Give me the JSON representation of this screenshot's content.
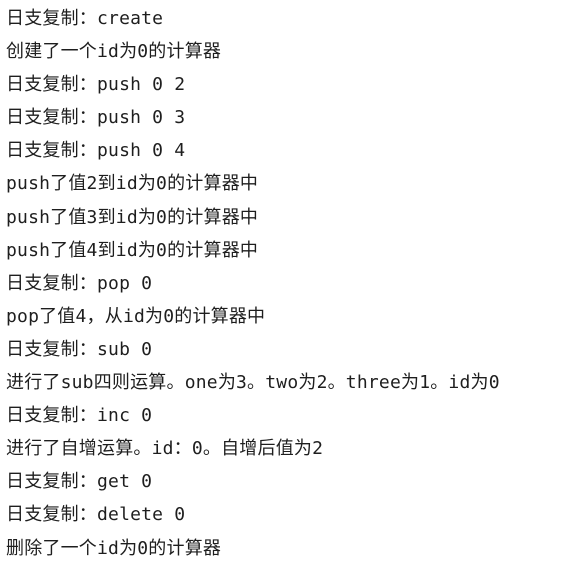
{
  "console": {
    "lines": [
      "日支复制：create",
      "创建了一个id为0的计算器",
      "日支复制：push 0 2",
      "日支复制：push 0 3",
      "日支复制：push 0 4",
      "push了值2到id为0的计算器中",
      "push了值3到id为0的计算器中",
      "push了值4到id为0的计算器中",
      "日支复制：pop 0",
      "pop了值4，从id为0的计算器中",
      "日支复制：sub 0",
      "进行了sub四则运算。one为3。two为2。three为1。id为0",
      "日支复制：inc 0",
      "进行了自增运算。id：0。自增后值为2",
      "日支复制：get 0",
      "日支复制：delete 0",
      "删除了一个id为0的计算器"
    ]
  }
}
